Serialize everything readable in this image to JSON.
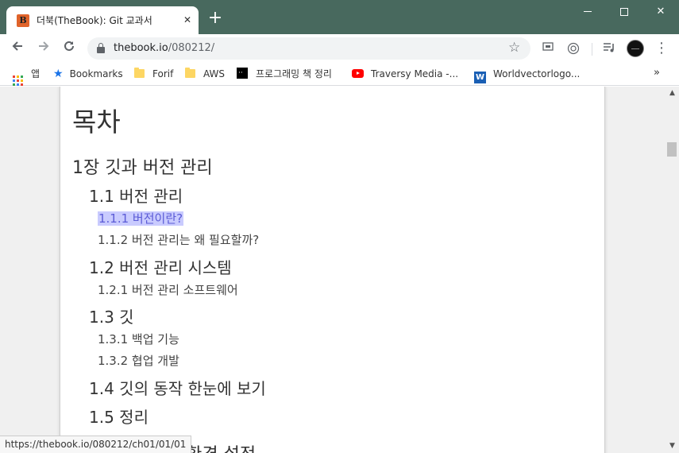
{
  "browser": {
    "tab": {
      "title": "더북(TheBook): Git 교과서",
      "favicon_letter": "B"
    },
    "new_tab_symbol": "+",
    "window_controls": {
      "close_symbol": "✕"
    },
    "url": {
      "host": "thebook.io",
      "path": "/080212/"
    },
    "bookmarks": [
      {
        "label": "앱",
        "icon": "apps-grid-icon"
      },
      {
        "label": "Bookmarks",
        "icon": "star-icon"
      },
      {
        "label": "Forif",
        "icon": "folder-icon"
      },
      {
        "label": "AWS",
        "icon": "folder-icon"
      },
      {
        "label": "프로그래밍 책 정리",
        "icon": "black-square-icon"
      },
      {
        "label": "Traversy Media -...",
        "icon": "youtube-icon"
      },
      {
        "label": "Worldvectorlogo...",
        "icon": "w-logo-icon"
      }
    ],
    "bookmarks_more": "»",
    "status_url": "https://thebook.io/080212/ch01/01/01"
  },
  "toc": {
    "title": "목차",
    "items": [
      {
        "level": 1,
        "text": "1장 깃과 버전 관리"
      },
      {
        "level": 2,
        "text": "1.1 버전 관리"
      },
      {
        "level": 3,
        "text": "1.1.1 버전이란?",
        "highlighted": true
      },
      {
        "level": 3,
        "text": "1.1.2 버전 관리는 왜 필요할까?"
      },
      {
        "level": 2,
        "text": "1.2 버전 관리 시스템"
      },
      {
        "level": 3,
        "text": "1.2.1 버전 관리 소프트웨어"
      },
      {
        "level": 2,
        "text": "1.3 깃"
      },
      {
        "level": 3,
        "text": "1.3.1 백업 기능"
      },
      {
        "level": 3,
        "text": "1.3.2 협업 개발"
      },
      {
        "level": 2,
        "text": "1.4 깃의 동작 한눈에 보기"
      },
      {
        "level": 2,
        "text": "1.5 정리"
      },
      {
        "level": 1,
        "text": "2장 깃 설치 및 환경 설정",
        "partially_visible": "툴 설치 및 환경 설정"
      }
    ]
  },
  "colors": {
    "titlebar": "#48695e",
    "highlight_bg": "#c9cbfe",
    "highlight_text": "#5b5bd6"
  }
}
